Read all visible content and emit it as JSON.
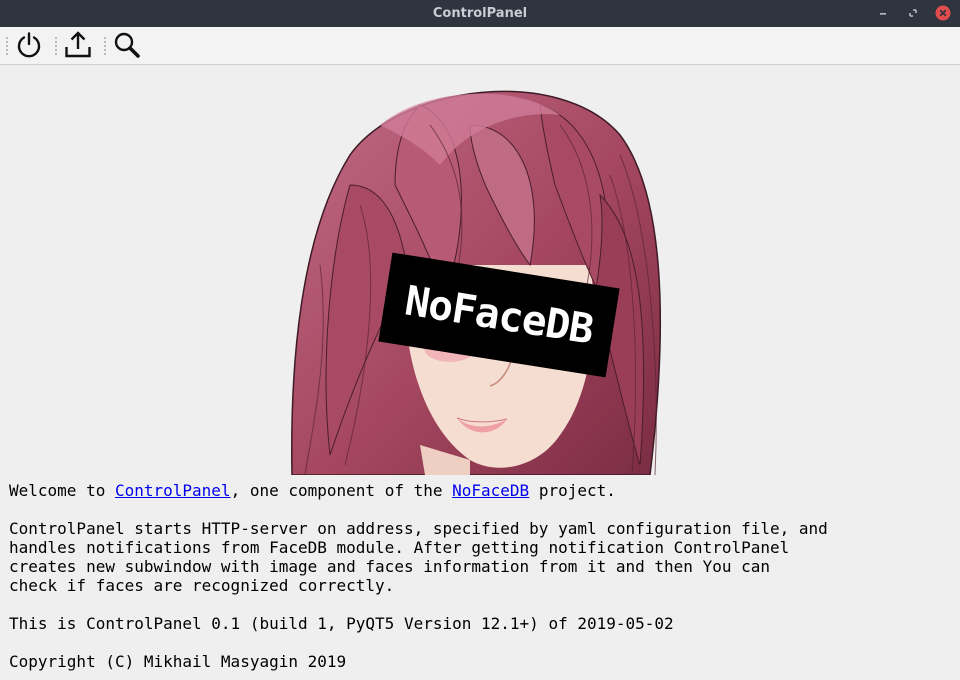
{
  "window": {
    "title": "ControlPanel"
  },
  "toolbar": {
    "buttons": [
      {
        "name": "power",
        "icon": "power-icon"
      },
      {
        "name": "upload",
        "icon": "upload-icon"
      },
      {
        "name": "search",
        "icon": "search-icon"
      }
    ]
  },
  "banner": {
    "logo_text": "NoFaceDB"
  },
  "about": {
    "welcome_pre": "Welcome to ",
    "link_controlpanel": "ControlPanel",
    "welcome_mid": ", one component of the ",
    "link_nofacedb": "NoFaceDB",
    "welcome_post": " project.",
    "desc_lines": [
      "ControlPanel starts HTTP-server on address, specified by yaml configuration file, and",
      "handles notifications from FaceDB module. After getting notification ControlPanel",
      "creates new subwindow with image and faces information from it and then You can",
      "check if faces are recognized correctly."
    ],
    "version": "This is ControlPanel 0.1 (build 1, PyQT5 Version 12.1+) of 2019-05-02",
    "copyright": "Copyright (C) Mikhail Masyagin 2019"
  },
  "colors": {
    "titlebar_bg": "#2f343f",
    "close": "#e14c4c",
    "link": "#0000ee",
    "hair": "#a4465f"
  }
}
